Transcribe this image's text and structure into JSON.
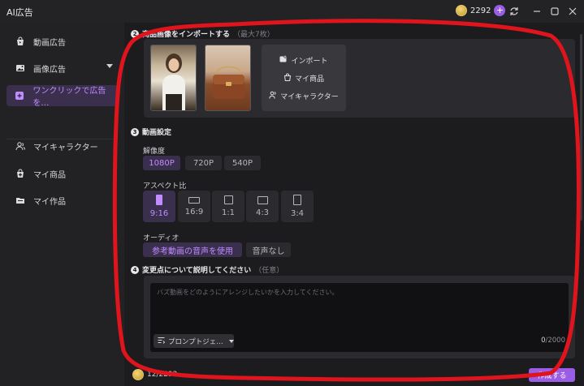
{
  "window": {
    "title": "AI広告",
    "credits": "2292",
    "plus": "+",
    "controls": {
      "minimize": "—",
      "maximize": "☐",
      "close": "✕"
    }
  },
  "sidebar": {
    "items": [
      {
        "label": "動画広告",
        "icon": "bag-icon"
      },
      {
        "label": "画像広告",
        "icon": "image-icon"
      },
      {
        "label": "ワンクリックで広告を…",
        "icon": "magic-icon",
        "active": true
      },
      {
        "label": "マイキャラクター",
        "icon": "person-icon"
      },
      {
        "label": "マイ商品",
        "icon": "product-bag-icon"
      },
      {
        "label": "マイ作品",
        "icon": "folder-icon"
      }
    ]
  },
  "import_section": {
    "step": "2",
    "title": "商品画像をインポートする",
    "hint": "（最大7枚）",
    "menu": {
      "import": "インポート",
      "my_products": "マイ商品",
      "my_characters": "マイキャラクター"
    }
  },
  "video_settings": {
    "step": "3",
    "title": "動画設定",
    "resolution_label": "解像度",
    "resolutions": [
      "1080P",
      "720P",
      "540P"
    ],
    "selected_resolution": "1080P",
    "aspect_label": "アスペクト比",
    "aspects": [
      "9:16",
      "16:9",
      "1:1",
      "4:3",
      "3:4"
    ],
    "selected_aspect": "9:16",
    "audio_label": "オーディオ",
    "audio_options": [
      "参考動画の音声を使用",
      "音声なし"
    ],
    "selected_audio": "参考動画の音声を使用"
  },
  "description": {
    "step": "4",
    "title": "変更点について説明してください",
    "hint": "（任意）",
    "placeholder": "バズ動画をどのようにアレンジしたいかを入力してください。",
    "prompt_button": "プロンプトジェ…",
    "count_current": "0",
    "count_max": "/2000"
  },
  "footer": {
    "credits": "12/2292",
    "create_label": "作成する"
  },
  "colors": {
    "accent": "#9b5de5",
    "accent_text": "#c08cff",
    "highlight": "#e0141c"
  }
}
